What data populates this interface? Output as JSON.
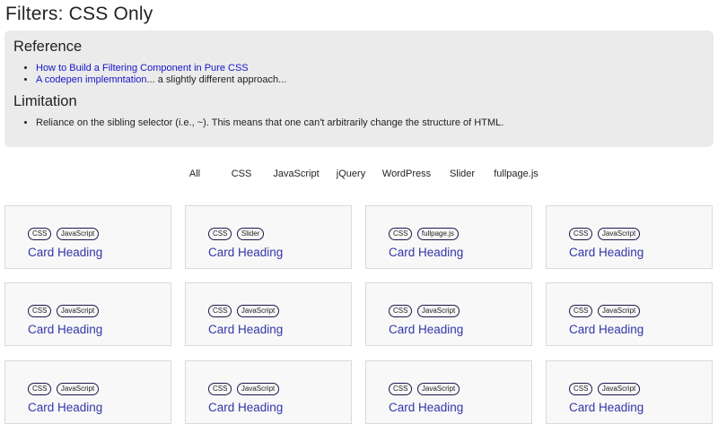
{
  "title": "Filters: CSS Only",
  "reference": {
    "heading": "Reference",
    "links": [
      {
        "text": "How to Build a Filtering Component in Pure CSS",
        "suffix": ""
      },
      {
        "text": "A codepen implemntation",
        "suffix": "... a slightly different approach..."
      }
    ]
  },
  "limitation": {
    "heading": "Limitation",
    "items": [
      "Reliance on the sibling selector (i.e., ~). This means that one can't arbitrarily change the structure of HTML."
    ]
  },
  "filters": [
    "All",
    "CSS",
    "JavaScript",
    "jQuery",
    "WordPress",
    "Slider",
    "fullpage.js"
  ],
  "colors": {
    "link": "#1515c8",
    "card_heading": "#3236a8",
    "info_bg": "#ebebeb"
  },
  "cards": [
    {
      "tags": [
        "CSS",
        "JavaScript"
      ],
      "heading": "Card Heading"
    },
    {
      "tags": [
        "CSS",
        "Slider"
      ],
      "heading": "Card Heading"
    },
    {
      "tags": [
        "CSS",
        "fullpage.js"
      ],
      "heading": "Card Heading"
    },
    {
      "tags": [
        "CSS",
        "JavaScript"
      ],
      "heading": "Card Heading"
    },
    {
      "tags": [
        "CSS",
        "JavaScript"
      ],
      "heading": "Card Heading"
    },
    {
      "tags": [
        "CSS",
        "JavaScript"
      ],
      "heading": "Card Heading"
    },
    {
      "tags": [
        "CSS",
        "JavaScript"
      ],
      "heading": "Card Heading"
    },
    {
      "tags": [
        "CSS",
        "JavaScript"
      ],
      "heading": "Card Heading"
    },
    {
      "tags": [
        "CSS",
        "JavaScript"
      ],
      "heading": "Card Heading"
    },
    {
      "tags": [
        "CSS",
        "JavaScript"
      ],
      "heading": "Card Heading"
    },
    {
      "tags": [
        "CSS",
        "JavaScript"
      ],
      "heading": "Card Heading"
    },
    {
      "tags": [
        "CSS",
        "JavaScript"
      ],
      "heading": "Card Heading"
    }
  ]
}
